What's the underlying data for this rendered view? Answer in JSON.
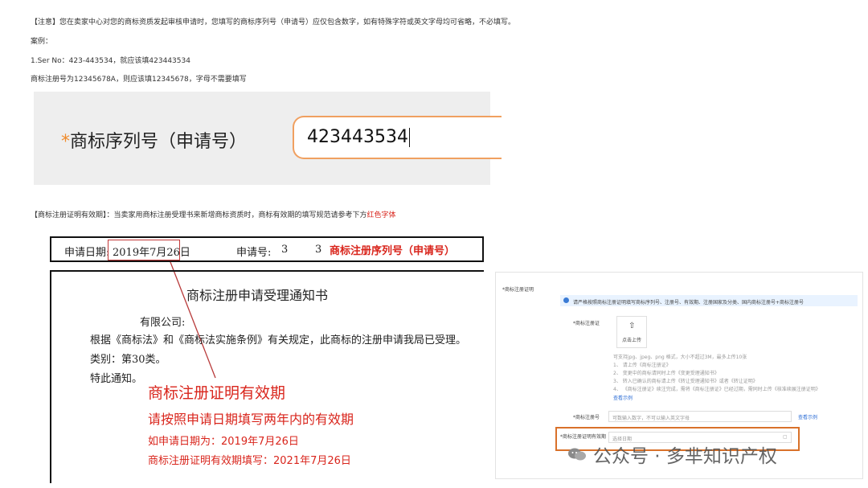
{
  "notes": {
    "line1": "【注意】您在卖家中心对您的商标资质发起审核申请时，您填写的商标序列号（申请号）应仅包含数字，如有特殊字符或英文字母均可省略，不必填写。",
    "line2": "案例：",
    "line3": "1.Ser No：423-443534，就应该填423443534",
    "line4": "商标注册号为12345678A，则应该填12345678，字母不需要填写"
  },
  "serial_panel": {
    "star": "*",
    "label": "商标序列号（申请号）",
    "value": "423443534"
  },
  "validity_note": {
    "prefix": "【商标注册证明有效期】：当卖家用商标注册受理书来新增商标资质时，商标有效期的填写规范请参考下方",
    "red_text": "红色字体"
  },
  "application_box": {
    "date_label": "申请日期:",
    "date_value": "2019年7月26日",
    "number_label": "申请号:",
    "number_frag1": "3",
    "number_frag2": "3",
    "serial_callout": "商标注册序列号（申请号）"
  },
  "notice": {
    "title": "商标注册申请受理通知书",
    "company": "有限公司:",
    "body": "根据《商标法》和《商标法实施条例》有关规定，此商标的注册申请我局已受理。",
    "category": "类别：第30类。",
    "closing": "特此通知。",
    "callout_title": "商标注册证明有效期",
    "callout_sub": "请按照申请日期填写两年内的有效期",
    "example_date": "如申请日期为：2019年7月26日",
    "example_validity": "商标注册证明有效期填写：2021年7月26日"
  },
  "form": {
    "section_label": "*商标注册证明",
    "info_text": "请严格按照商标注册证明填写商标序列号、注册号、有效期、注册国家及分类、国内商标注册号+商标注册号",
    "cert_label": "*商标注册证",
    "upload_icon": "upload-icon",
    "upload_label": "点击上传",
    "upload_hint": "可支持jpg、jpeg、png 格式，大小不超过3M，最多上传10张",
    "hint1": "1、    请上传《商标注册证》",
    "hint2": "2、    变更中的商标请同时上传《变更受理通知书》",
    "hint3": "3、    转入已确认的商标请上传《转让受理通知书》或者《转让证明》",
    "hint4": "4、    《商标注册证》续注完成，需将《商标注册证》已经过期，需同时上传《核准续展注册证明》",
    "view_example": "查看示例",
    "serial_label": "*商标注册号",
    "serial_placeholder": "可数输入数字，不可以输入英文字母",
    "serial_example": "查看示例",
    "validity_label": "*商标注册证明有效期",
    "validity_placeholder": "选择日期"
  },
  "watermark": {
    "icon": "wechat-icon",
    "text": "公众号 · 多芈知识产权"
  },
  "colors": {
    "accent_red": "#d9251c",
    "orange": "#f08a2a",
    "link_blue": "#2f6fd6"
  }
}
